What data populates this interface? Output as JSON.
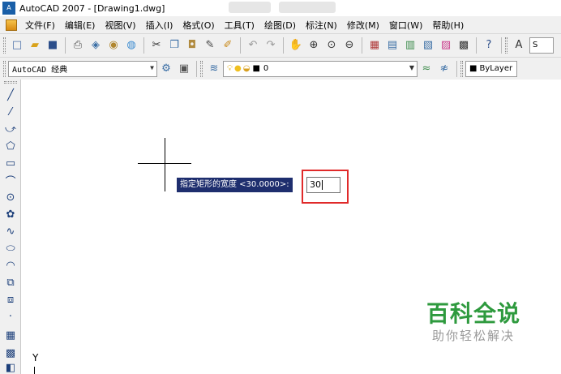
{
  "window": {
    "title": "AutoCAD 2007 - [Drawing1.dwg]",
    "app_icon_text": "A"
  },
  "menu": {
    "items": [
      "文件(F)",
      "编辑(E)",
      "视图(V)",
      "插入(I)",
      "格式(O)",
      "工具(T)",
      "绘图(D)",
      "标注(N)",
      "修改(M)",
      "窗口(W)",
      "帮助(H)"
    ]
  },
  "toolbar": {
    "icons": [
      "new-icon",
      "open-icon",
      "save-icon",
      "print-icon",
      "preview-icon",
      "publish-icon",
      "3d-icon",
      "cut-icon",
      "copy-icon",
      "paste-icon",
      "matchprop-icon",
      "brush-icon",
      "undo-icon",
      "redo-icon",
      "pan-icon",
      "zoom-realtime-icon",
      "zoom-window-icon",
      "zoom-prev-icon",
      "properties-icon",
      "designcenter-icon",
      "toolpalette-icon",
      "sheetset-icon",
      "markup-icon",
      "calculator-icon",
      "help-icon",
      "text-style-icon"
    ],
    "partial_text": "S"
  },
  "workspace": {
    "label": "AutoCAD 经典"
  },
  "layer": {
    "value": "0"
  },
  "color": {
    "value": "ByLayer"
  },
  "draw_tools": [
    "line-icon",
    "construction-line-icon",
    "polyline-icon",
    "polygon-icon",
    "rectangle-icon",
    "arc-icon",
    "circle-icon",
    "revision-cloud-icon",
    "spline-icon",
    "ellipse-icon",
    "ellipse-arc-icon",
    "insert-block-icon",
    "make-block-icon",
    "point-icon",
    "hatch-icon",
    "gradient-icon"
  ],
  "command": {
    "prompt": "指定矩形的宽度 <30.0000>:",
    "input_value": "30"
  },
  "ucs": {
    "y_label": "Y"
  },
  "watermark": {
    "title": "百科全说",
    "subtitle": "助你轻松解决"
  },
  "colors": {
    "prompt_bg": "#1e2e6e",
    "highlight": "#e02a2a",
    "watermark_green": "#2e9a3e"
  }
}
